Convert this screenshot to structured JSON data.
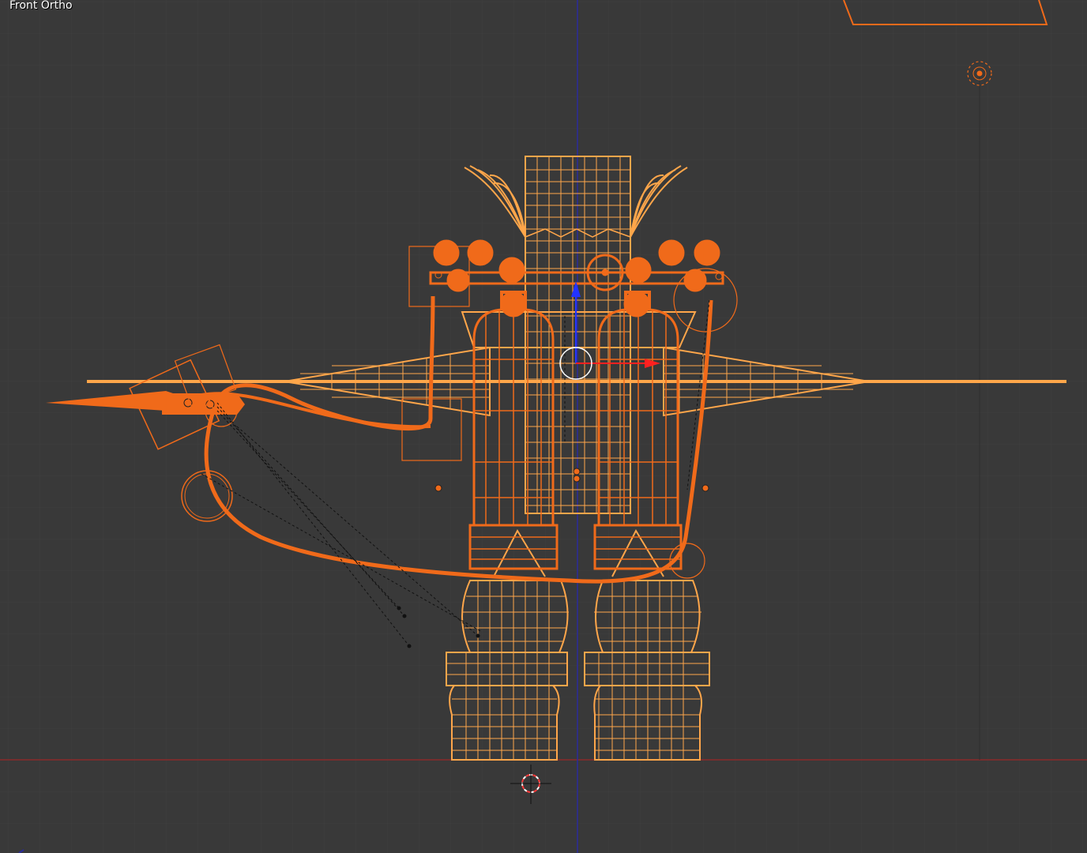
{
  "viewport": {
    "view_label": "Front Ortho"
  },
  "colors": {
    "background": "#393939",
    "grid_minor": "#404040",
    "grid_major": "#4a4a4a",
    "axis_x": "#8a2a2a",
    "axis_z": "#2a2a9a",
    "selected_active": "#ffa64a",
    "selected": "#f06a1a",
    "gizmo_z": "#2233ff",
    "gizmo_x": "#ff2020"
  },
  "icons": {
    "cursor": "3d-cursor-icon",
    "lamp": "lamp-icon",
    "gizmo": "transform-manipulator-icon"
  }
}
